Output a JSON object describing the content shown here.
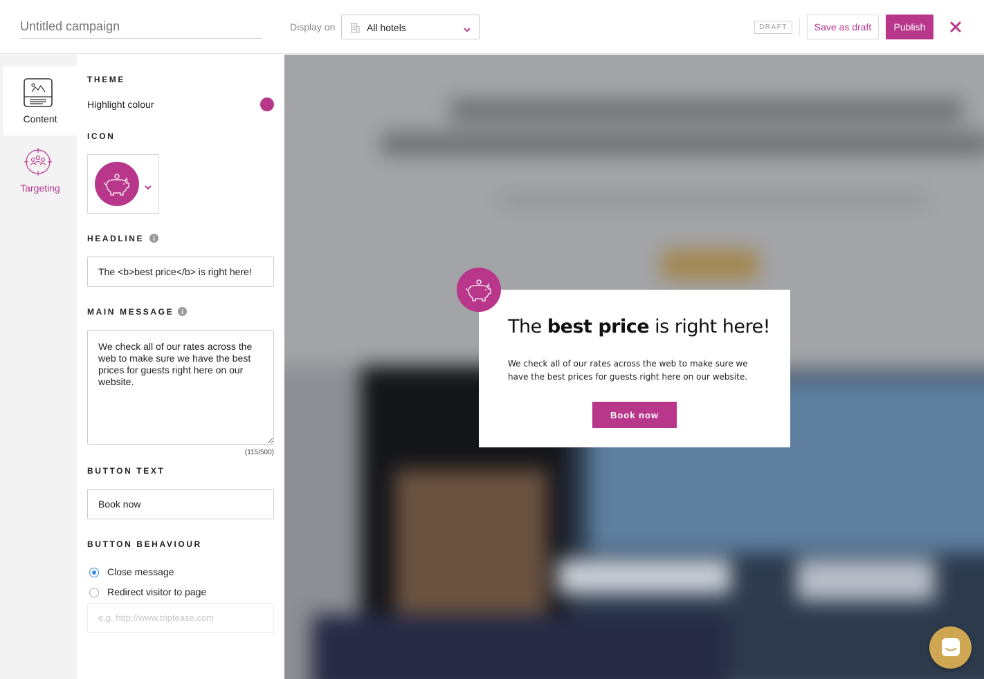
{
  "header": {
    "campaign_name_placeholder": "Untitled campaign",
    "display_on_label": "Display on",
    "hotel_select_value": "All hotels",
    "status_badge": "DRAFT",
    "save_draft_label": "Save as draft",
    "publish_label": "Publish"
  },
  "nav": {
    "content_label": "Content",
    "targeting_label": "Targeting"
  },
  "panel": {
    "theme_title": "THEME",
    "highlight_label": "Highlight colour",
    "highlight_color": "#b8378a",
    "icon_title": "ICON",
    "selected_icon": "piggy-bank-icon",
    "headline_title": "HEADLINE",
    "headline_value": "The <b>best price</b> is right here!",
    "message_title": "MAIN MESSAGE",
    "message_value": "We check all of our rates across the web to make sure we have the best prices for guests right here on our website.",
    "message_counter": "(115/500)",
    "button_text_title": "BUTTON TEXT",
    "button_text_value": "Book now",
    "behaviour_title": "BUTTON BEHAVIOUR",
    "behaviour_options": [
      "Close message",
      "Redirect visitor to page"
    ],
    "behaviour_selected": "Close message",
    "url_placeholder": "e.g. http://www.triptease.com"
  },
  "preview": {
    "headline_pre": "The ",
    "headline_bold": "best price",
    "headline_post": " is right here!",
    "message": "We check all of our rates across the web to make sure we have the best prices for guests right here on our website.",
    "button_label": "Book now"
  },
  "colors": {
    "accent": "#b8378a",
    "chat": "#cfa752",
    "radio_selected": "#3a8ee6"
  }
}
